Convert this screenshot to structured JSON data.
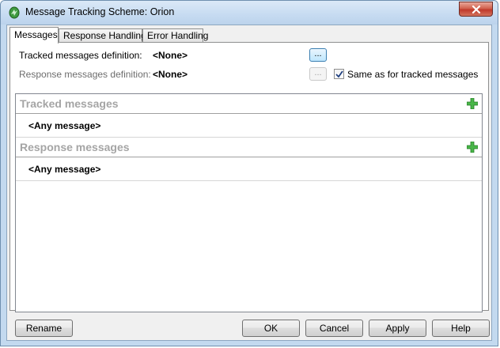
{
  "window": {
    "title": "Message Tracking Scheme: Orion"
  },
  "tabs": [
    {
      "label": "Messages"
    },
    {
      "label": "Response Handling"
    },
    {
      "label": "Error Handling"
    }
  ],
  "definitions": {
    "tracked_label": "Tracked messages definition:",
    "tracked_value": "<None>",
    "response_label": "Response messages definition:",
    "response_value": "<None>",
    "browse_label": "...",
    "same_as_label": "Same as for tracked messages",
    "same_as_checked": true
  },
  "groups": [
    {
      "title": "Tracked messages",
      "rows": [
        "<Any message>"
      ]
    },
    {
      "title": "Response messages",
      "rows": [
        "<Any message>"
      ]
    }
  ],
  "buttons": {
    "rename": "Rename",
    "ok": "OK",
    "cancel": "Cancel",
    "apply": "Apply",
    "help": "Help"
  },
  "icons": {
    "app": "message-tracking-icon",
    "close": "close-icon",
    "add": "green-plus-icon"
  }
}
